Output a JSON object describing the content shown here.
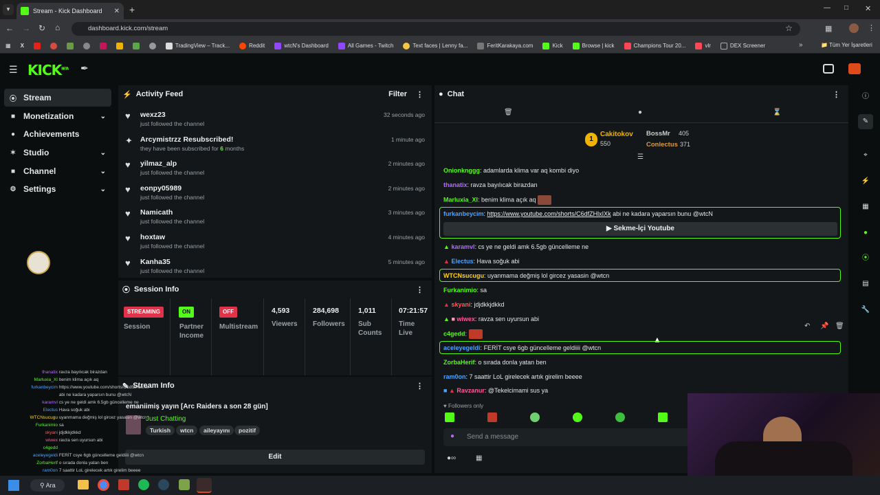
{
  "browser": {
    "tab_title": "Stream - Kick Dashboard",
    "url": "dashboard.kick.com/stream",
    "bookmarks": [
      "TradingView – Track...",
      "Reddit",
      "wtcN's Dashboard",
      "All Games - Twitch",
      "Text faces | Lenny fa...",
      "FeritKarakaya.com",
      "Kick",
      "Browse | kick",
      "Champions Tour 20...",
      "vlr",
      "DEX Screener"
    ],
    "bookmarks_folder": "Tüm Yer İşaretleri"
  },
  "brand": {
    "logo": "KICK",
    "beta": "BETA",
    "accent": "#53fc18"
  },
  "sidebar": {
    "items": [
      {
        "label": "Stream",
        "icon": "stream-icon",
        "active": true
      },
      {
        "label": "Monetization",
        "icon": "dollar-icon"
      },
      {
        "label": "Achievements",
        "icon": "trophy-icon"
      },
      {
        "label": "Studio",
        "icon": "studio-icon"
      },
      {
        "label": "Channel",
        "icon": "channel-icon"
      },
      {
        "label": "Settings",
        "icon": "gear-icon"
      }
    ]
  },
  "activity": {
    "title": "Activity Feed",
    "filter": "Filter",
    "items": [
      {
        "name": "wexz23",
        "text": "just followed the channel",
        "time": "32 seconds ago"
      },
      {
        "name": "Arcymistrzz Resubscribed!",
        "text": "they have been subscribed for",
        "months": "6",
        "months_suffix": "months",
        "time": "1 minute ago"
      },
      {
        "name": "yilmaz_alp",
        "text": "just followed the channel",
        "time": "2 minutes ago"
      },
      {
        "name": "eonpy05989",
        "text": "just followed the channel",
        "time": "2 minutes ago"
      },
      {
        "name": "Namicath",
        "text": "just followed the channel",
        "time": "3 minutes ago"
      },
      {
        "name": "hoxtaw",
        "text": "just followed the channel",
        "time": "4 minutes ago"
      },
      {
        "name": "Kanha35",
        "text": "just followed the channel",
        "time": "5 minutes ago"
      }
    ]
  },
  "session": {
    "title": "Session Info",
    "streaming": "STREAMING",
    "session_label": "Session",
    "on": "ON",
    "partner": "Partner",
    "income": "Income",
    "off": "OFF",
    "multistream": "Multistream",
    "viewers": "4,593",
    "viewers_label": "Viewers",
    "followers": "284,698",
    "followers_label": "Followers",
    "subs": "1,011",
    "subs_label1": "Sub",
    "subs_label2": "Counts",
    "time": "07:21:57",
    "time_label1": "Time",
    "time_label2": "Live"
  },
  "streaminfo": {
    "title": "Stream Info",
    "stream_title": "emaniimiş yayın [Arc Raiders a son 28 gün]",
    "category": "Just Chatting",
    "tags": [
      "Turkish",
      "wtcn",
      "aileyayını",
      "pozitif"
    ],
    "edit": "Edit"
  },
  "chat": {
    "title": "Chat",
    "top": [
      {
        "rank": "1",
        "name": "Cakitokov",
        "amount": "550"
      },
      {
        "name": "BossMr",
        "amount": "405"
      },
      {
        "name": "Conlectus",
        "amount": "371"
      }
    ],
    "messages": [
      {
        "user": "Onionknggg",
        "text": "adamlarda klima var aq kombi diyo",
        "color": "#53fc18"
      },
      {
        "user": "thanatix",
        "text": "ravza bayılıcak birazdan",
        "color": "#b36bff"
      },
      {
        "user": "Marluxia_XI",
        "text": "benim klima açık aq",
        "color": "#53fc18"
      },
      {
        "user": "furkanbeycim",
        "text": "abi ne kadara yaparsın bunu @wtcN",
        "link": "https://www.youtube.com/shorts/C6dfZHlxIXk",
        "color": "#4aa3ff"
      },
      {
        "user": "karamvl",
        "text": "cs ye ne geldi amk 6.5gb güncelleme ne",
        "color": "#b36bff"
      },
      {
        "user": "Electus",
        "text": "Hava soğuk abi",
        "color": "#4aa3ff"
      },
      {
        "user": "WTCNsucugu",
        "text": "uyanmama değmiş lol gircez yasasin @wtcn",
        "color": "#ffd21f"
      },
      {
        "user": "Furkanimio",
        "text": "sa",
        "color": "#53fc18"
      },
      {
        "user": "skyani",
        "text": "jdjdkkjdkkd",
        "color": "#ff5a5a"
      },
      {
        "user": "wiwex",
        "text": "ravza sen uyursun abi",
        "color": "#ff5a9a"
      },
      {
        "user": "c4gedd",
        "text": "",
        "color": "#53fc18"
      },
      {
        "user": "aceleyegeldi",
        "text": "FERİT csye 6gb güncelleme geldiiii @wtcn",
        "color": "#4aa3ff"
      },
      {
        "user": "ZorbaHerif",
        "text": "o sırada donla yatan ben",
        "color": "#53fc18"
      },
      {
        "user": "ram0on",
        "text": "7 saattir LoL girelecek artık girelim beeee",
        "color": "#4aa3ff"
      },
      {
        "user": "Ravzanur",
        "text": "@Tekelcimami sus ya",
        "color": "#ff5a9a"
      }
    ],
    "youtube_button": "Sekme-İçi Youtube",
    "followers_only": "Followers only",
    "placeholder": "Send a message"
  },
  "overlay_chat": [
    {
      "user": "thanatix",
      "text": "ravza bayılıcak birazdan"
    },
    {
      "user": "Marluxia_XI",
      "text": "benim klima açık aq"
    },
    {
      "user": "furkanbeycim",
      "text": "https://www.youtube.com/shorts/C6dfZHlxIXk"
    },
    {
      "user": "",
      "text": "abi ne kadara yaparsın bunu @wtcN"
    },
    {
      "user": "karamvl",
      "text": "cs ye ne geldi amk 6.5gb güncelleme ne"
    },
    {
      "user": "Electus",
      "text": "Hava soğuk abi"
    },
    {
      "user": "WTCNsucugu",
      "text": "uyanmama değmiş lol gircez yasasin @wtcn"
    },
    {
      "user": "Furkanimio",
      "text": "sa"
    },
    {
      "user": "skyani",
      "text": "jdjdkkjdkkd"
    },
    {
      "user": "wiwex",
      "text": "ravza sen uyursun abi"
    },
    {
      "user": "c4gedd",
      "text": ""
    },
    {
      "user": "aceleyegeldi",
      "text": "FERİT csye 6gb güncelleme geldiiii @wtcn"
    },
    {
      "user": "ZorbaHerif",
      "text": "o sırada donla yatan ben"
    },
    {
      "user": "ram0on",
      "text": "7 saattir LoL girelecek artık girelim beeee"
    }
  ],
  "taskbar": {
    "search": "Ara"
  }
}
